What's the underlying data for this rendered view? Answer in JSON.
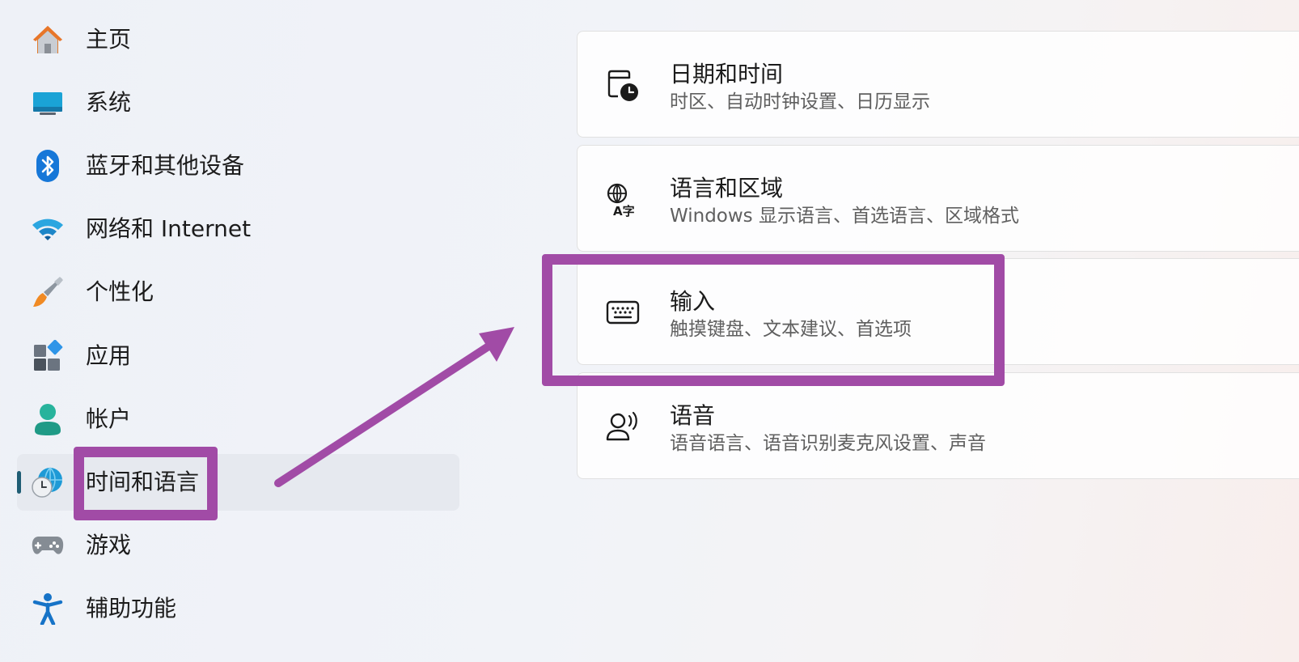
{
  "sidebar": {
    "items": [
      {
        "label": "主页",
        "icon": "home-icon"
      },
      {
        "label": "系统",
        "icon": "monitor-icon"
      },
      {
        "label": "蓝牙和其他设备",
        "icon": "bluetooth-icon"
      },
      {
        "label": "网络和 Internet",
        "icon": "wifi-icon"
      },
      {
        "label": "个性化",
        "icon": "paintbrush-icon"
      },
      {
        "label": "应用",
        "icon": "apps-icon"
      },
      {
        "label": "帐户",
        "icon": "account-icon"
      },
      {
        "label": "时间和语言",
        "icon": "globe-clock-icon",
        "selected": true
      },
      {
        "label": "游戏",
        "icon": "gamepad-icon"
      },
      {
        "label": "辅助功能",
        "icon": "accessibility-icon"
      }
    ]
  },
  "main": {
    "cards": [
      {
        "title": "日期和时间",
        "subtitle": "时区、自动时钟设置、日历显示",
        "icon": "calendar-clock-icon"
      },
      {
        "title": "语言和区域",
        "subtitle": "Windows 显示语言、首选语言、区域格式",
        "icon": "language-icon"
      },
      {
        "title": "输入",
        "subtitle": "触摸键盘、文本建议、首选项",
        "icon": "keyboard-icon"
      },
      {
        "title": "语音",
        "subtitle": "语音语言、语音识别麦克风设置、声音",
        "icon": "speech-icon"
      }
    ]
  },
  "annotations": {
    "color": "#a14ba6",
    "highlighted_nav": "时间和语言",
    "highlighted_card": "输入"
  },
  "colors": {
    "accent": "#1f5d74",
    "selected_bg": "#e6e9ef",
    "card_bg": "#ffffff",
    "subtitle_text": "#5f5f5f"
  }
}
